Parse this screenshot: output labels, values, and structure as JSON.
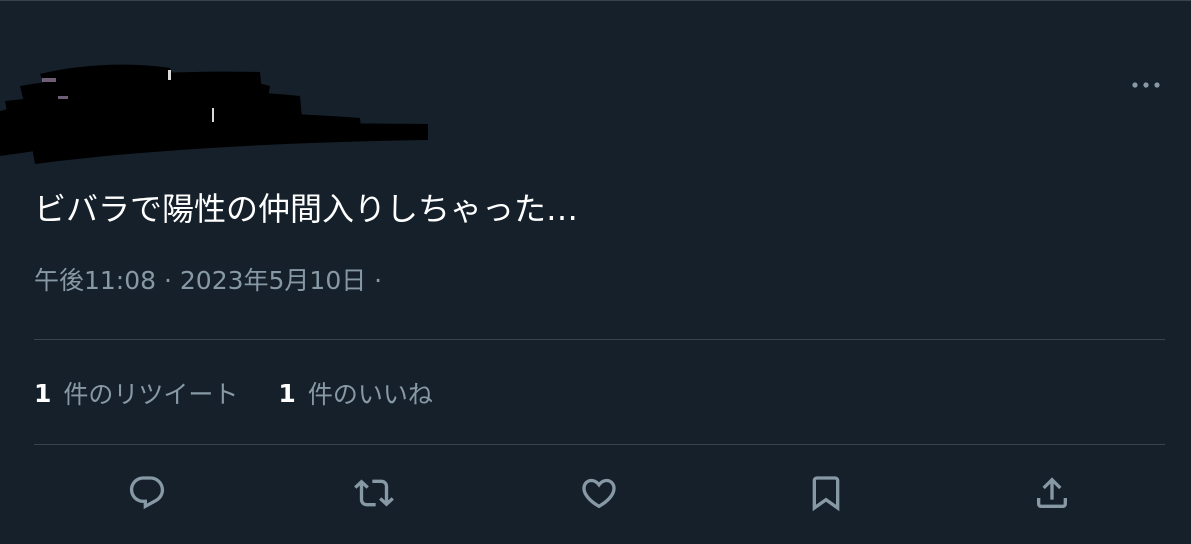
{
  "tweet": {
    "handle_fragment": "@",
    "text": "ビバラで陽性の仲間入りしちゃった…",
    "timestamp": "午後11:08 · 2023年5月10日 ·"
  },
  "stats": {
    "retweets": {
      "count": "1",
      "label": "件のリツイート"
    },
    "likes": {
      "count": "1",
      "label": "件のいいね"
    }
  },
  "actions": [
    "reply-icon",
    "retweet-icon",
    "like-icon",
    "bookmark-icon",
    "share-icon"
  ],
  "colors": {
    "background": "#15202b",
    "text": "#ffffff",
    "secondary_text": "#8899a6",
    "divider": "#38444d",
    "icon": "#8899a6"
  }
}
